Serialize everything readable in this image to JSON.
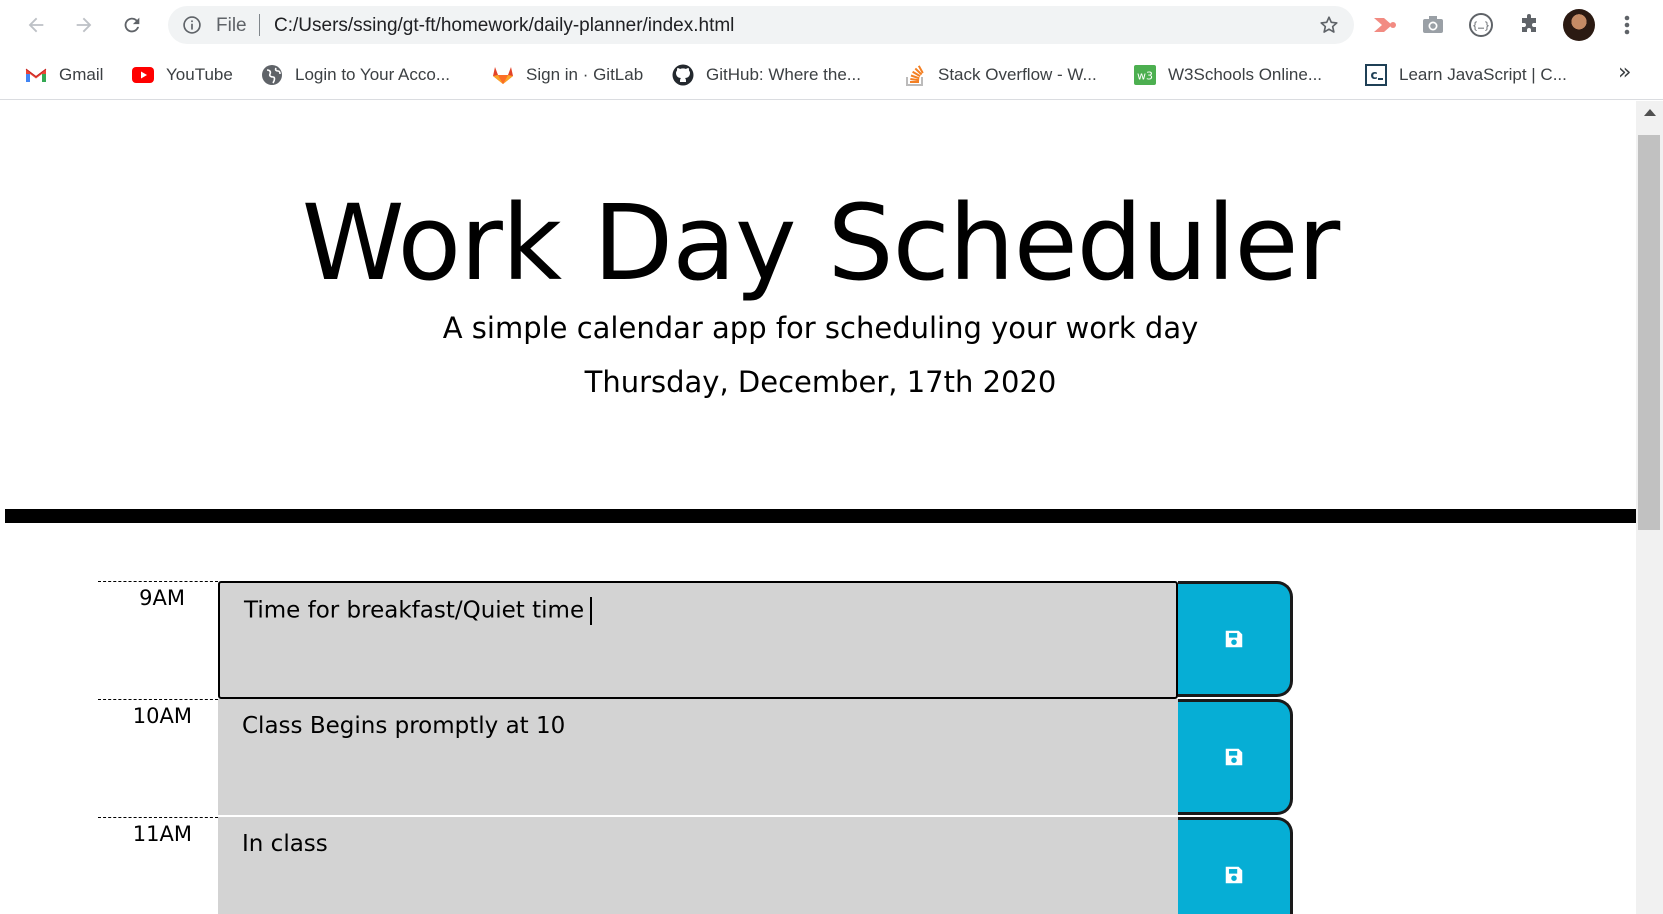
{
  "browser": {
    "url_scheme_label": "File",
    "url": "C:/Users/ssing/gt-ft/homework/daily-planner/index.html",
    "bookmarks": [
      {
        "label": "Gmail",
        "icon": "gmail-icon"
      },
      {
        "label": "YouTube",
        "icon": "youtube-icon"
      },
      {
        "label": "Login to Your Acco...",
        "icon": "globe-icon"
      },
      {
        "label": "Sign in · GitLab",
        "icon": "gitlab-icon"
      },
      {
        "label": "GitHub: Where the...",
        "icon": "github-icon"
      },
      {
        "label": "Stack Overflow - W...",
        "icon": "stackoverflow-icon"
      },
      {
        "label": "W3Schools Online...",
        "icon": "w3schools-icon"
      },
      {
        "label": "Learn JavaScript | C...",
        "icon": "codecademy-icon"
      }
    ],
    "more_bookmarks": "»"
  },
  "header": {
    "title": "Work Day Scheduler",
    "subtitle": "A simple calendar app for scheduling your work day",
    "current_date": "Thursday, December, 17th 2020"
  },
  "schedule": [
    {
      "hour": "9AM",
      "text": "Time for breakfast/Quiet time"
    },
    {
      "hour": "10AM",
      "text": "Class Begins promptly at 10"
    },
    {
      "hour": "11AM",
      "text": "In class"
    }
  ],
  "colors": {
    "save_button": "#06aed5",
    "time_block": "#d3d3d3",
    "divider": "#000000"
  }
}
